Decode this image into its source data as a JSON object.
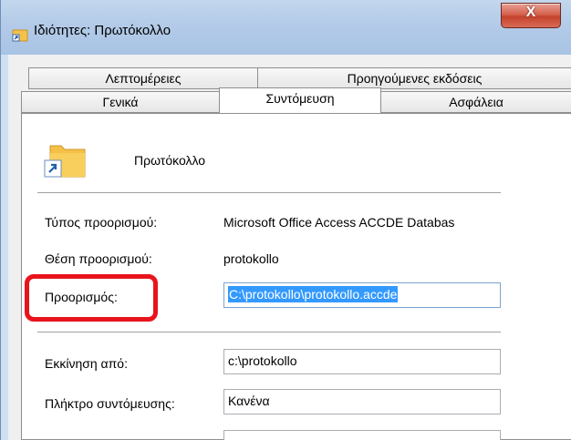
{
  "window": {
    "title": "Ιδιότητες: Πρωτόκολλο",
    "close_label": "X"
  },
  "tabs": {
    "row_back": [
      "Λεπτομέρειες",
      "Προηγούμενες εκδόσεις"
    ],
    "row_front": [
      "Γενικά",
      "Συντόμευση",
      "Ασφάλεια"
    ],
    "active": "Συντόμευση"
  },
  "shortcut": {
    "name": "Πρωτόκολλο",
    "target_type_label": "Τύπος προορισμού:",
    "target_type_value": "Microsoft Office Access ACCDE Databas",
    "target_location_label": "Θέση προορισμού:",
    "target_location_value": "protokollo",
    "target_label": "Προορισμός:",
    "target_value": "C:\\protokollo\\protokollo.accde",
    "start_in_label": "Εκκίνηση από:",
    "start_in_value": "c:\\protokollo",
    "shortcut_key_label": "Πλήκτρο συντόμευσης:",
    "shortcut_key_value": "Κανένα"
  },
  "colors": {
    "highlight": "#3399ff",
    "callout": "#e8141c",
    "titlebar": "#b3cbe8"
  }
}
